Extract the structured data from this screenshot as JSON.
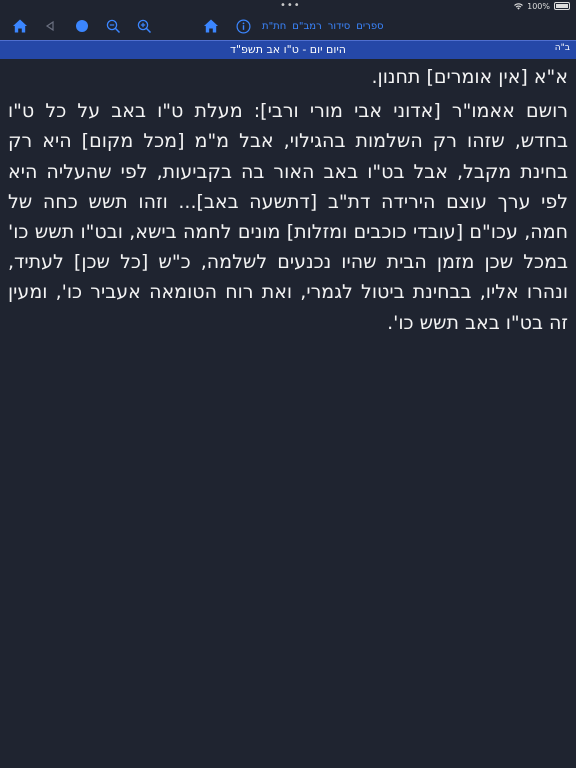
{
  "status": {
    "dots": "•••",
    "battery_text": "100%"
  },
  "toolbar": {
    "links": [
      "ספרים",
      "סידור",
      "רמב\"ם",
      "חת\"ת"
    ],
    "colors": {
      "accent": "#3b86ff",
      "home": "#3b86ff",
      "disabled": "#6a7080"
    },
    "icons": [
      "home-icon",
      "back-arrow-icon",
      "dot-icon",
      "zoom-out-icon",
      "zoom-in-icon",
      "home-icon",
      "info-icon"
    ]
  },
  "datebar": {
    "bh": "ב\"ה",
    "date": "היום יום - ט\"ו אב תשפ\"ד",
    "color": "#2548a8"
  },
  "content": {
    "line1": "א\"א [אין אומרים] תחנון.",
    "paragraph": "רושם אאמו\"ר [אדוני אבי מורי ורבי]: מעלת ט\"ו באב על כל ט\"ו בחדש, שזהו רק השלמות בהגילוי, אבל מ\"מ [מכל מקום] היא רק בחינת מקבל, אבל בט\"ו באב האור בה בקביעות, לפי שהעליה היא לפי ערך עוצם הירידה דת\"ב [דתשעה באב]... וזהו תשש כחה של חמה, עכו\"ם [עובדי כוכבים ומזלות] מונים לחמה בישא, ובט\"ו תשש כו' במכל שכן מזמן הבית שהיו נכנעים לשלמה, כ\"ש [כל שכן] לעתיד, ונהרו אליו, בבחינת ביטול לגמרי, ואת רוח הטומאה אעביר כו', ומעין זה בט\"ו באב תשש כו'."
  }
}
